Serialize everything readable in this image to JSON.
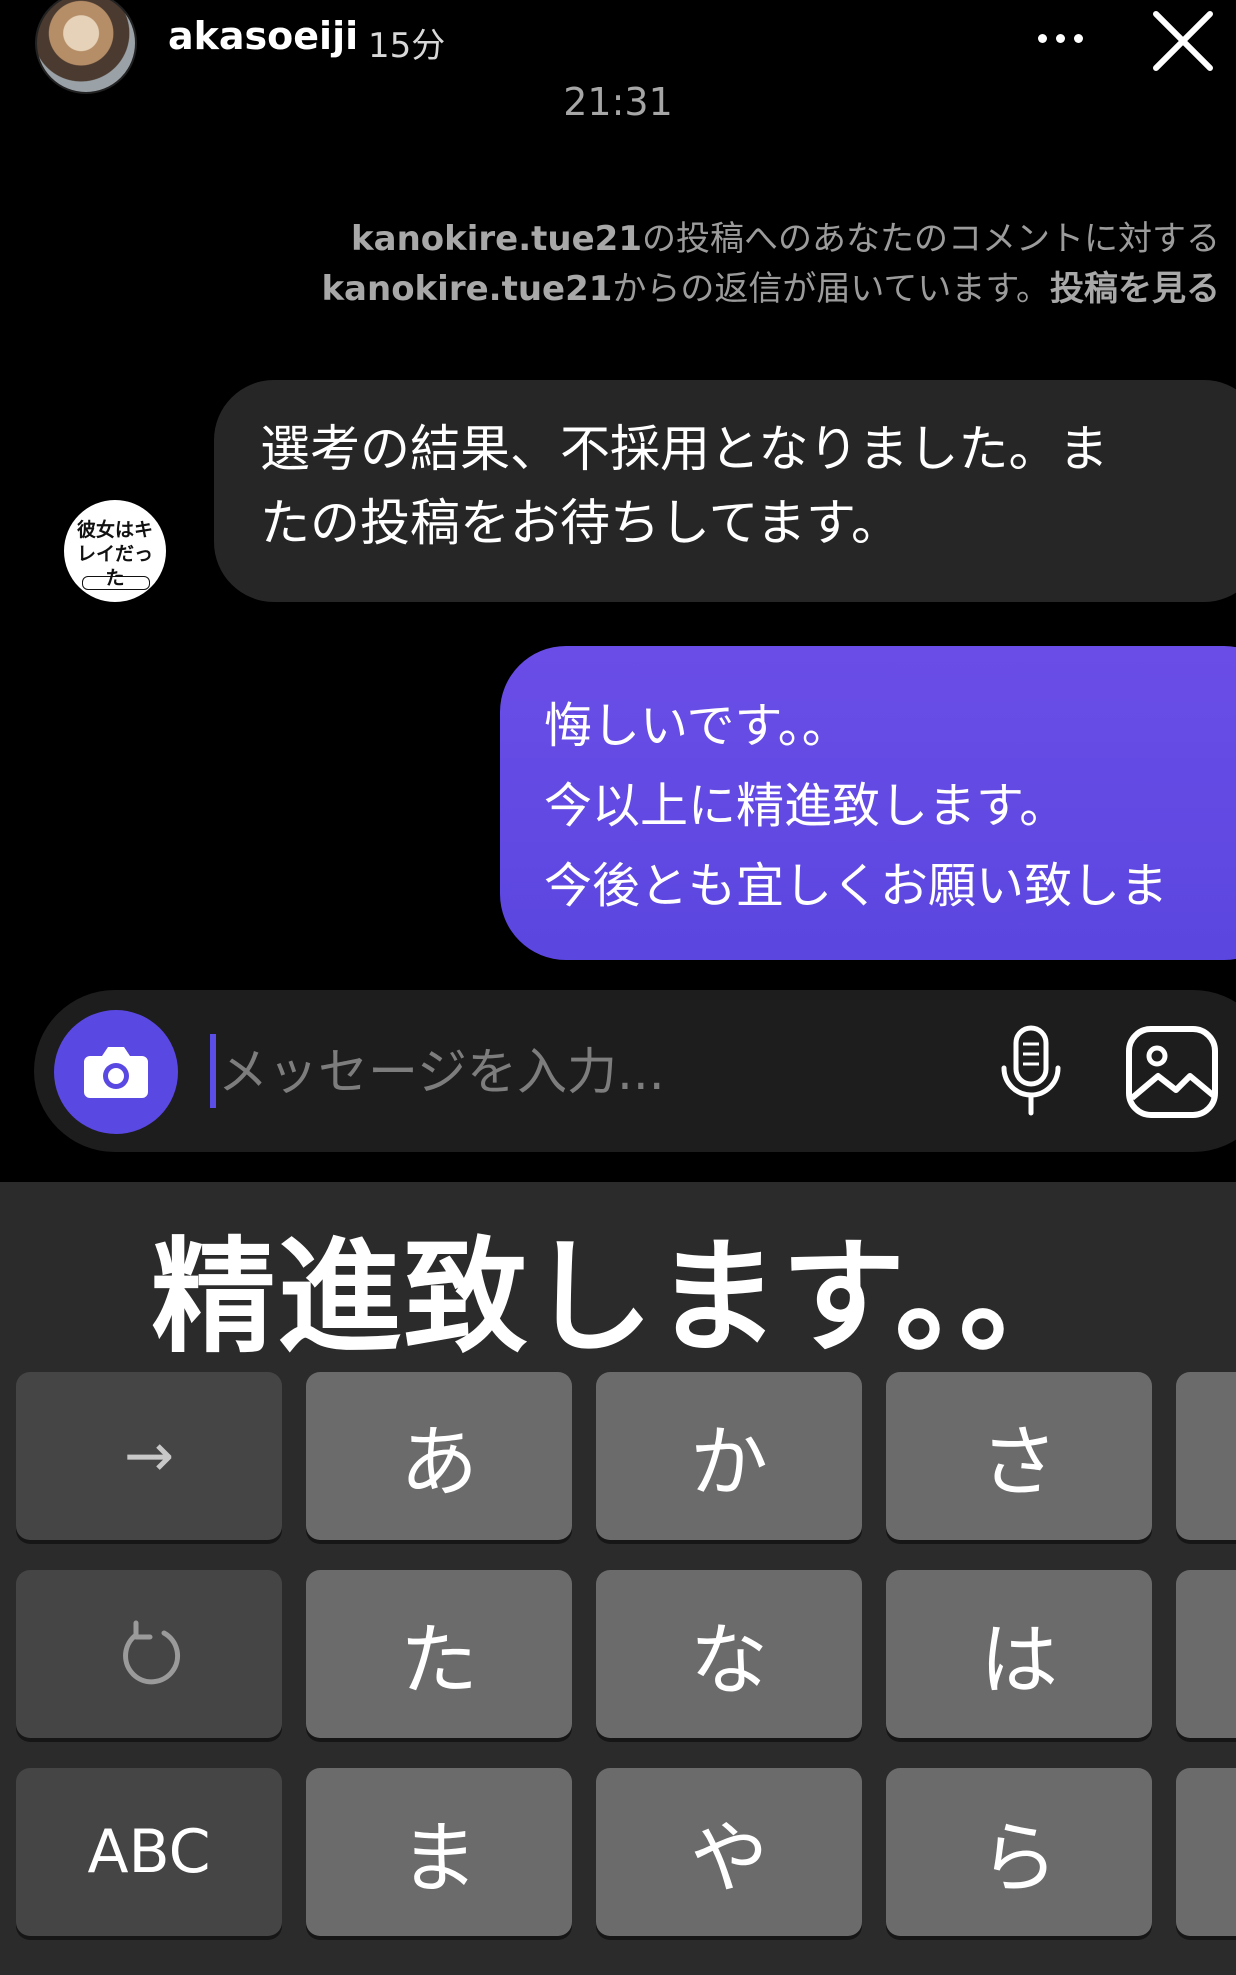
{
  "header": {
    "username": "akasoeiji",
    "time_ago": "15分"
  },
  "chat": {
    "timestamp": "21:31",
    "notice": {
      "account": "kanokire.tue21",
      "text1": "の投稿へのあなたのコメントに対する",
      "text2": "からの返信が届いています。",
      "link": "投稿を見る"
    },
    "incoming": {
      "line1": "選考の結果、不採用となりました。ま",
      "line2": "たの投稿をお待ちしてます。",
      "avatar_text": "彼女はキレイだった"
    },
    "outgoing": {
      "line1": "悔しいです。。",
      "line2": "今以上に精進致します。",
      "line3": "今後とも宜しくお願い致しま"
    }
  },
  "composer": {
    "placeholder": "メッセージを入力..."
  },
  "keyboard": {
    "candidate": "精進致します。。",
    "row1": [
      "→",
      "あ",
      "か",
      "さ"
    ],
    "row2": [
      "↻",
      "た",
      "な",
      "は"
    ],
    "row3": [
      "ABC",
      "ま",
      "や",
      "ら"
    ]
  },
  "icons": {
    "more": "more-icon",
    "close": "close-icon",
    "camera": "camera-icon",
    "mic": "microphone-icon",
    "gallery": "gallery-icon",
    "undo": "undo-icon"
  },
  "colors": {
    "outgoing_bubble": "#5b46e0",
    "camera_button": "#5a48e2",
    "incoming_bubble": "#262626"
  }
}
